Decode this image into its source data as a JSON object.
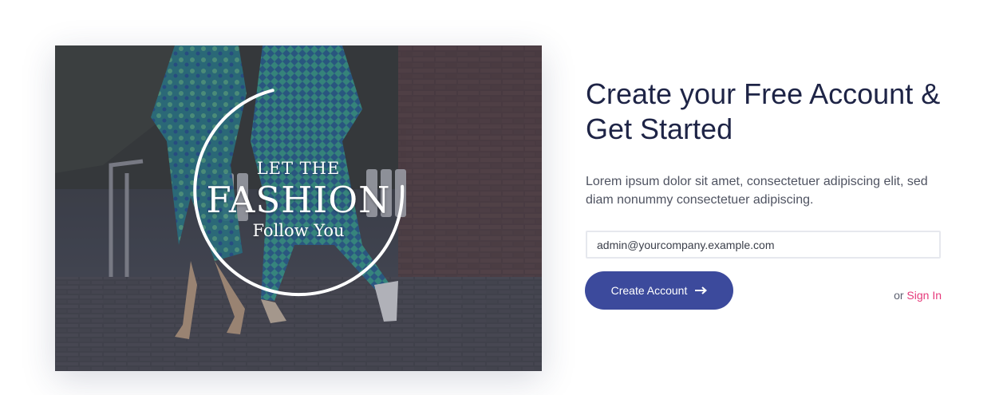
{
  "hero": {
    "line1": "LET THE",
    "line2": "FASHION",
    "line3": "Follow You"
  },
  "signup": {
    "title": "Create your Free Account & Get Started",
    "description": "Lorem ipsum dolor sit amet, consectetuer adipiscing elit, sed diam nonummy consectetuer adipiscing.",
    "email_value": "admin@yourcompany.example.com",
    "create_label": "Create Account",
    "or_text": "or",
    "signin_label": "Sign In"
  },
  "colors": {
    "primary": "#3c4a9c",
    "accent": "#e63a7b",
    "heading": "#1e2446"
  },
  "icons": {
    "button_icon": "arrow-right-icon"
  }
}
